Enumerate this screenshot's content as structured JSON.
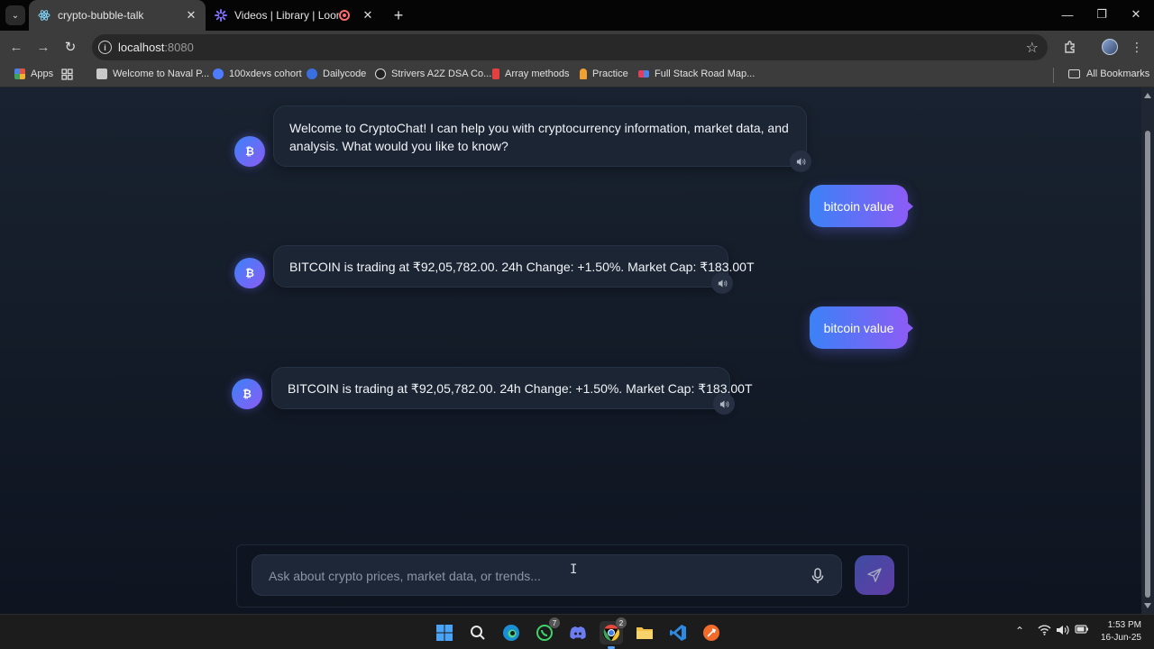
{
  "browser": {
    "tabs": [
      {
        "title": "crypto-bubble-talk",
        "favicon": "react-atom-icon",
        "active": true
      },
      {
        "title": "Videos | Library | Loom",
        "favicon": "loom-icon",
        "active": false
      }
    ],
    "address": {
      "host": "localhost",
      "port": ":8080"
    },
    "bookmarks": [
      {
        "label": "Apps",
        "icon": "apps-grid-icon",
        "color": "#e2553c"
      },
      {
        "label": "Welcome to Naval P...",
        "icon": "naval-icon",
        "color": "#c9c9c9"
      },
      {
        "label": "100xdevs cohort",
        "icon": "100x-icon",
        "color": "#4f7cff"
      },
      {
        "label": "Dailycode",
        "icon": "dailycode-icon",
        "color": "#3a6fe0"
      },
      {
        "label": "Strivers A2Z DSA Co...",
        "icon": "tuf-icon",
        "color": "#dddddd"
      },
      {
        "label": "Array methods",
        "icon": "array-icon",
        "color": "#e34040"
      },
      {
        "label": "Practice",
        "icon": "practice-icon",
        "color": "#f0a030"
      },
      {
        "label": "Full Stack Road Map...",
        "icon": "roadmap-icon",
        "color": "#e0405a"
      }
    ],
    "all_bookmarks_label": "All Bookmarks"
  },
  "chat": {
    "bot_avatar_glyph": "₿",
    "messages": [
      {
        "role": "bot",
        "text": "Welcome to CryptoChat! I can help you with cryptocurrency information, market data, and analysis. What would you like to know?"
      },
      {
        "role": "user",
        "text": "bitcoin value"
      },
      {
        "role": "bot",
        "text": "BITCOIN is trading at ₹92,05,782.00. 24h Change: +1.50%. Market Cap: ₹183.00T"
      },
      {
        "role": "user",
        "text": "bitcoin value"
      },
      {
        "role": "bot",
        "text": "BITCOIN is trading at ₹92,05,782.00. 24h Change: +1.50%. Market Cap: ₹183.00T"
      }
    ],
    "composer": {
      "placeholder": "Ask about crypto prices, market data, or trends..."
    },
    "colors": {
      "accent_start": "#3b82f6",
      "accent_end": "#8b5cf6",
      "bubble_bg": "#1b2534"
    }
  },
  "taskbar": {
    "apps": [
      "windows-start-icon",
      "search-icon",
      "edge-icon",
      "whatsapp-icon",
      "discord-icon",
      "chrome-icon",
      "file-explorer-icon",
      "vscode-icon",
      "postman-icon"
    ],
    "whatsapp_badge": "7",
    "chrome_badge": "2",
    "time": "1:53 PM",
    "date": "16-Jun-25"
  }
}
